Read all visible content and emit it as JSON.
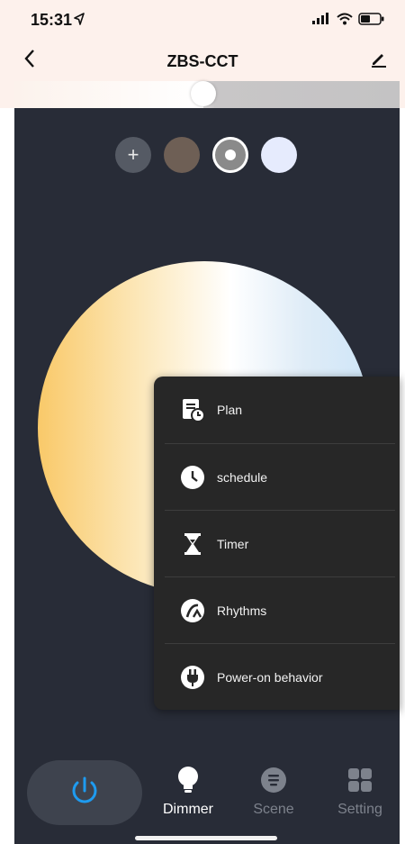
{
  "status_bar": {
    "time": "15:31"
  },
  "nav": {
    "title": "ZBS-CCT"
  },
  "brightness": {
    "level": 0.49
  },
  "swatches": [
    {
      "name": "add",
      "color": "#555a64"
    },
    {
      "name": "warm-brown",
      "color": "#6e5f55"
    },
    {
      "name": "neutral-gray",
      "color": "#8a8a8a",
      "selected": true
    },
    {
      "name": "cool-white",
      "color": "#e6ebfd"
    }
  ],
  "menu": {
    "items": [
      {
        "label": "Plan",
        "icon": "plan-icon"
      },
      {
        "label": "schedule",
        "icon": "clock-icon"
      },
      {
        "label": "Timer",
        "icon": "hourglass-icon"
      },
      {
        "label": "Rhythms",
        "icon": "rhythm-icon"
      },
      {
        "label": "Power-on behavior",
        "icon": "plug-icon"
      }
    ]
  },
  "bottom_nav": {
    "tabs": [
      {
        "label": "Dimmer",
        "icon": "bulb-icon",
        "active": true
      },
      {
        "label": "Scene",
        "icon": "scene-icon",
        "active": false
      },
      {
        "label": "Setting",
        "icon": "grid-icon",
        "active": false
      }
    ]
  },
  "colors": {
    "panel": "#282c37",
    "menu_bg": "#272727",
    "power_accent": "#1e9bf0",
    "header_bg": "#fdf1ec"
  }
}
